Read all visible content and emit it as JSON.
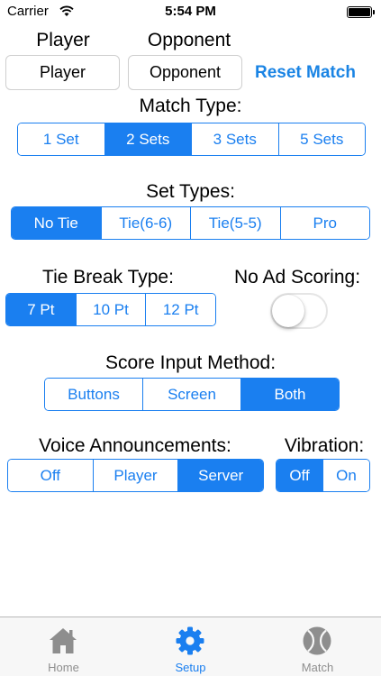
{
  "status_bar": {
    "carrier": "Carrier",
    "time": "5:54 PM"
  },
  "players": {
    "player_label": "Player",
    "opponent_label": "Opponent",
    "player_button": "Player",
    "opponent_button": "Opponent",
    "reset_button": "Reset Match"
  },
  "match_type": {
    "label": "Match Type:",
    "options": [
      "1 Set",
      "2 Sets",
      "3 Sets",
      "5 Sets"
    ],
    "selected": "2 Sets"
  },
  "set_types": {
    "label": "Set Types:",
    "options": [
      "No Tie",
      "Tie(6-6)",
      "Tie(5-5)",
      "Pro"
    ],
    "selected": "No Tie"
  },
  "tie_break": {
    "label": "Tie Break Type:",
    "options": [
      "7 Pt",
      "10 Pt",
      "12 Pt"
    ],
    "selected": "7 Pt"
  },
  "no_ad": {
    "label": "No Ad Scoring:",
    "on": false
  },
  "score_input": {
    "label": "Score Input Method:",
    "options": [
      "Buttons",
      "Screen",
      "Both"
    ],
    "selected": "Both"
  },
  "voice": {
    "label": "Voice Announcements:",
    "options": [
      "Off",
      "Player",
      "Server"
    ],
    "selected": "Server"
  },
  "vibration": {
    "label": "Vibration:",
    "options": [
      "Off",
      "On"
    ],
    "selected": "Off"
  },
  "tab_bar": {
    "tabs": [
      {
        "label": "Home",
        "icon": "house-icon"
      },
      {
        "label": "Setup",
        "icon": "gear-icon"
      },
      {
        "label": "Match",
        "icon": "tennis-ball-icon"
      }
    ],
    "active": "Setup"
  },
  "colors": {
    "accent": "#1a7ff0",
    "reset": "#1a84e4",
    "tab_inactive": "#8e8e8e"
  }
}
